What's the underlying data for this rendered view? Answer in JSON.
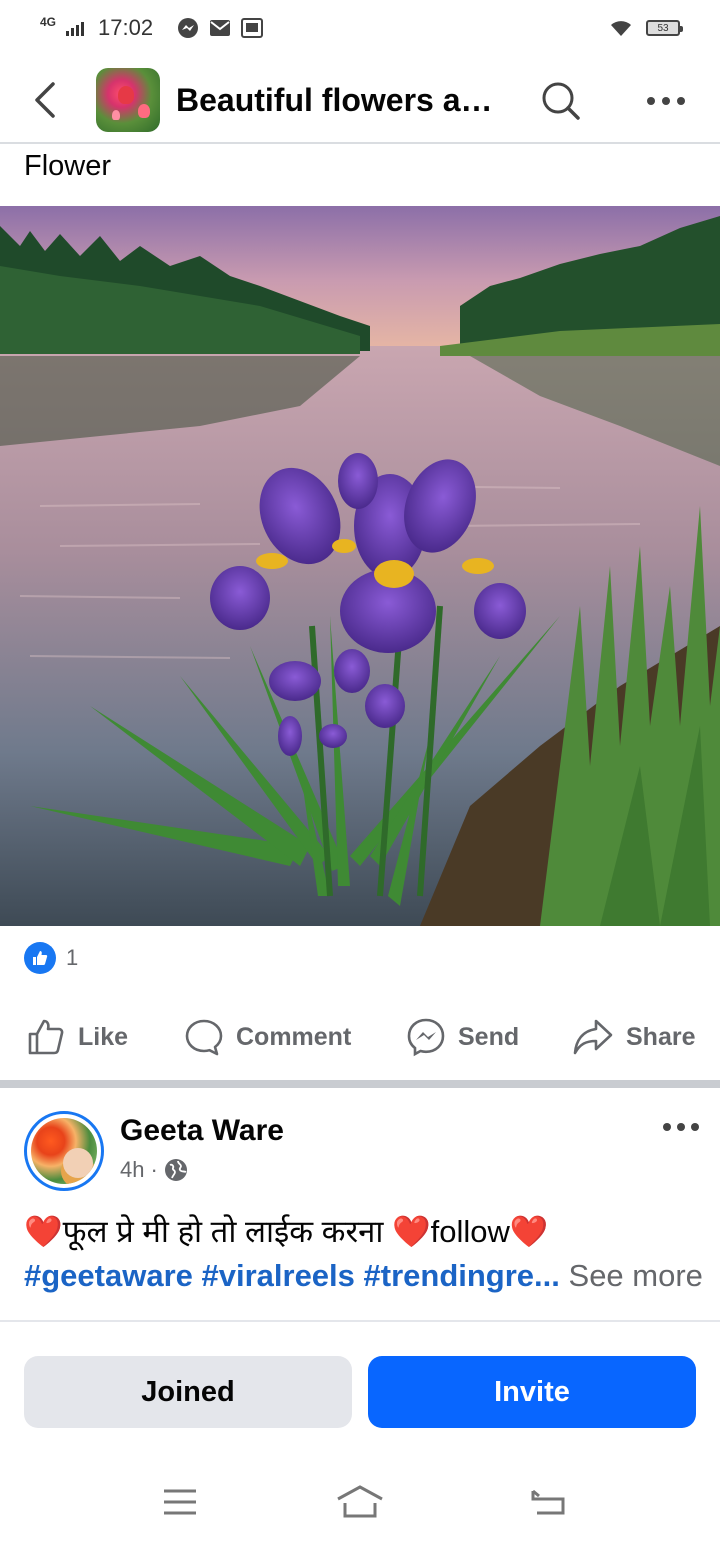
{
  "status_bar": {
    "network": "4G",
    "time": "17:02",
    "battery": "53",
    "icons": [
      "messenger-icon",
      "mail-icon",
      "inbox-icon",
      "wifi-icon",
      "battery-icon"
    ]
  },
  "header": {
    "title": "Beautiful flowers and...",
    "icons": [
      "back-arrow-icon",
      "search-icon",
      "more-icon"
    ]
  },
  "post": {
    "caption": "Flower",
    "reaction_count": "1",
    "actions": {
      "like": "Like",
      "comment": "Comment",
      "send": "Send",
      "share": "Share"
    }
  },
  "next_post": {
    "author": "Geeta Ware",
    "time": "4h",
    "dot": "·",
    "text_parts": {
      "heart": "❤️",
      "line1": "फूल प्रे मी हो तो लाईक करना ",
      "follow": "follow"
    },
    "hashtags": "#geetaware #viralreels #trendingre...",
    "see_more": "See more"
  },
  "bottom_bar": {
    "joined": "Joined",
    "invite": "Invite"
  },
  "colors": {
    "facebook_blue": "#1877f2",
    "invite_blue": "#0866ff",
    "hashtag_blue": "#1b64c5",
    "heart_red": "#e0102b",
    "secondary_text": "#65676b"
  }
}
